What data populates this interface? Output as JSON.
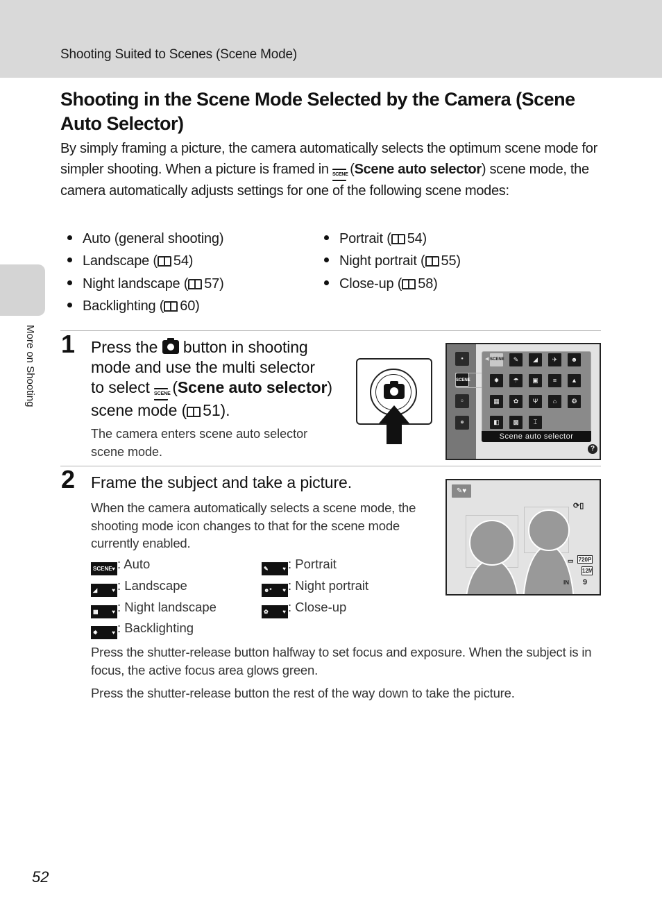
{
  "header": {
    "section_title": "Shooting Suited to Scenes (Scene Mode)"
  },
  "side_tab": {
    "label": "More on Shooting"
  },
  "page_title": "Shooting in the Scene Mode Selected by the Camera (Scene Auto Selector)",
  "intro": {
    "part1": "By simply framing a picture, the camera automatically selects the optimum scene mode for simpler shooting. When a picture is framed in ",
    "icon": "scene-auto-icon",
    "paren_open": " (",
    "bold": "Scene auto selector",
    "part2": ") scene mode, the camera automatically adjusts settings for one of the following scene modes:"
  },
  "scene_modes": {
    "col1": [
      {
        "label": "Auto (general shooting)",
        "page": ""
      },
      {
        "label": "Landscape (",
        "page": "54)"
      },
      {
        "label": "Night landscape (",
        "page": "57)"
      },
      {
        "label": "Backlighting (",
        "page": "60)"
      }
    ],
    "col2": [
      {
        "label": "Portrait (",
        "page": "54)"
      },
      {
        "label": "Night portrait (",
        "page": "55)"
      },
      {
        "label": "Close-up (",
        "page": "58)"
      }
    ]
  },
  "step1": {
    "number": "1",
    "line1_a": "Press the ",
    "line1_b": " button in shooting",
    "line2": "mode and use the multi selector",
    "line3_a": "to select ",
    "line3_paren": " (",
    "line3_bold": "Scene auto selector",
    "line3_close": ")",
    "line4_a": "scene mode (",
    "line4_page": "51).",
    "note": "The camera enters scene auto selector scene mode.",
    "menu_caption": "Scene auto selector",
    "menu_side_icons": [
      "camera",
      "SCENE",
      "smile",
      "target"
    ],
    "menu_grid": [
      [
        "SCENE",
        "✎",
        "◢",
        "✈",
        "☻"
      ],
      [
        "✸",
        "☂",
        "▣",
        "≡",
        "▲"
      ],
      [
        "▦",
        "✿",
        "Ψ",
        "⌂",
        "❂"
      ],
      [
        "◧",
        "▩",
        "⌶"
      ]
    ],
    "help": "?"
  },
  "step2": {
    "number": "2",
    "heading": "Frame the subject and take a picture.",
    "body": "When the camera automatically selects a scene mode, the shooting mode icon changes to that for the scene mode currently enabled.",
    "legend": [
      {
        "icon": "SCENE",
        "label": ": Auto"
      },
      {
        "icon": "◢",
        "label": ": Landscape"
      },
      {
        "icon": "▦",
        "label": ": Night landscape"
      },
      {
        "icon": "✸",
        "label": ": Backlighting"
      },
      {
        "icon": "✎",
        "label": ": Portrait"
      },
      {
        "icon": "☻*",
        "label": ": Night portrait"
      },
      {
        "icon": "✿",
        "label": ": Close-up"
      }
    ],
    "para1": "Press the shutter-release button halfway to set focus and exposure. When the subject is in focus, the active focus area glows green.",
    "para2": "Press the shutter-release button the rest of the way down to take the picture.",
    "screen": {
      "mode_badge": "✎♥",
      "movie_quality": "720P",
      "image_size": "12M",
      "exposures_remaining": "9",
      "internal_memory": "IN"
    }
  },
  "page_number": "52"
}
